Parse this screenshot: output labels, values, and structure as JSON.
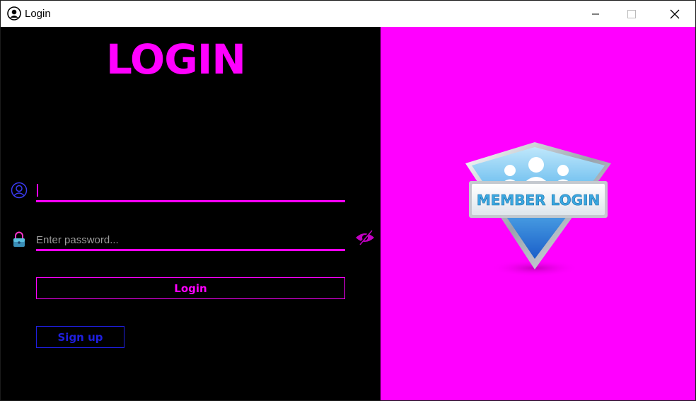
{
  "window": {
    "title": "Login",
    "icon": "user-circle-icon",
    "controls": [
      "minimize-icon",
      "maximize-icon",
      "close-icon"
    ]
  },
  "form": {
    "heading": "LOGIN",
    "username": {
      "value": "",
      "placeholder": "",
      "icon": "user-circle-icon"
    },
    "password": {
      "value": "",
      "placeholder": "Enter password...",
      "icon": "lock-icon",
      "toggle_icon": "eye-slash-icon"
    },
    "login_label": "Login",
    "signup_label": "Sign up"
  },
  "badge": {
    "text": "MEMBER LOGIN"
  },
  "colors": {
    "accent": "#ff00ff",
    "panel_left": "#000000",
    "panel_right": "#ff00ff",
    "signup": "#1f1fe0"
  }
}
